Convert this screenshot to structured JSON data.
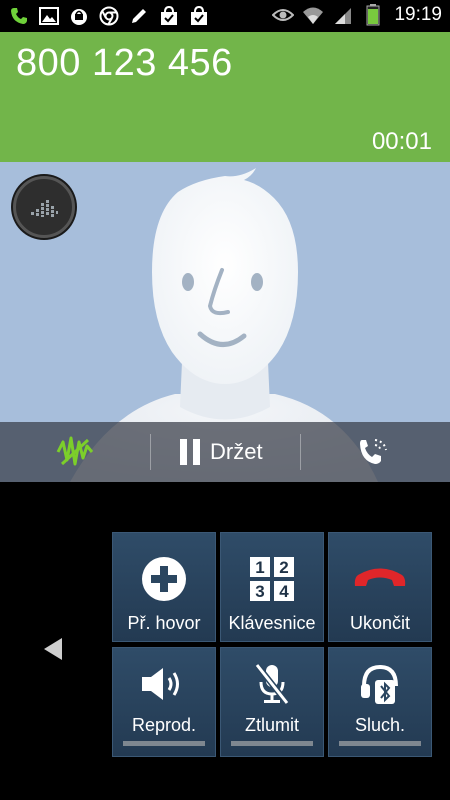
{
  "status_bar": {
    "time": "19:19",
    "left_icons": [
      "phone-icon",
      "image-icon",
      "bag-icon",
      "chrome-icon",
      "pen-icon",
      "shopping-check-icon",
      "shopping-check-icon"
    ],
    "right_icons": [
      "eye-icon",
      "wifi-icon",
      "signal-icon",
      "battery-icon"
    ]
  },
  "call": {
    "number": "800 123 456",
    "timer": "00:01",
    "header_color": "#72b54a"
  },
  "hold_bar": {
    "hold_label": "Držet",
    "left_icon": "noise-reduction-icon",
    "right_icon": "extra-volume-icon"
  },
  "actions": [
    {
      "label": "Př. hovor",
      "icon": "add-call-icon"
    },
    {
      "label": "Klávesnice",
      "icon": "keypad-icon"
    },
    {
      "label": "Ukončit",
      "icon": "end-call-icon"
    },
    {
      "label": "Reprod.",
      "icon": "speaker-icon"
    },
    {
      "label": "Ztlumit",
      "icon": "mute-icon"
    },
    {
      "label": "Sluch.",
      "icon": "bluetooth-headset-icon"
    }
  ],
  "keypad_digits": [
    "1",
    "2",
    "3",
    "4"
  ],
  "colors": {
    "accent_green": "#72b54a",
    "button_bg": "#2b4660",
    "end_call_red": "#e0262a",
    "contact_bg": "#a7bedb"
  }
}
